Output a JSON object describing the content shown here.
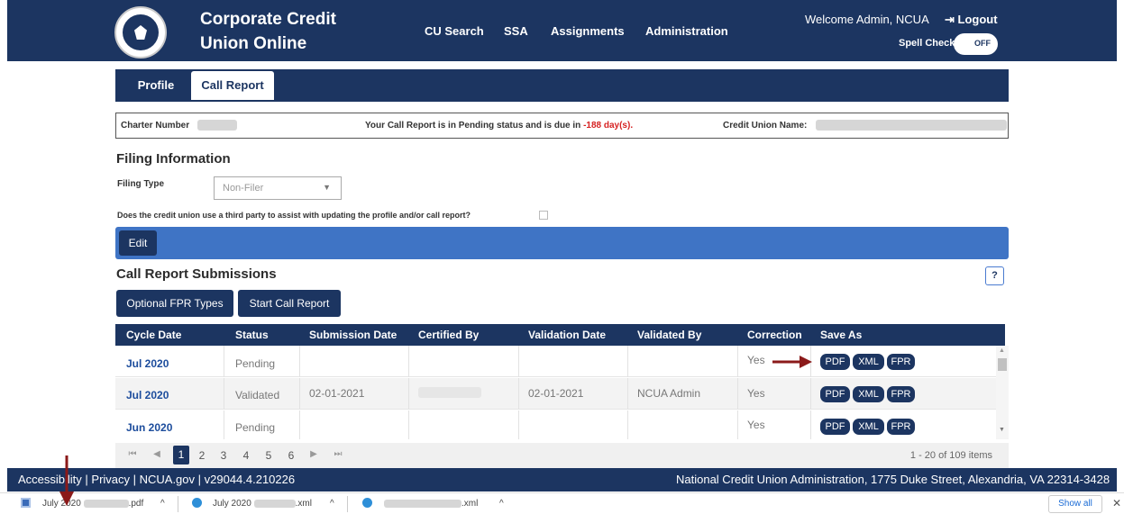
{
  "header": {
    "brand_line1": "Corporate Credit",
    "brand_line2": "Union Online",
    "nav": [
      "CU Search",
      "SSA",
      "Assignments",
      "Administration"
    ],
    "welcome": "Welcome Admin, NCUA",
    "logout": "Logout",
    "spell_check_label": "Spell Check",
    "spell_check_state": "OFF"
  },
  "tabs": [
    "Profile",
    "Call Report"
  ],
  "charter": {
    "charter_label": "Charter Number",
    "status_prefix": "Your Call Report is in Pending status and is due in",
    "due_days": "-188 day(s).",
    "cu_name_label": "Credit Union Name:"
  },
  "filing": {
    "heading": "Filing Information",
    "type_label": "Filing Type",
    "type_value": "Non-Filer",
    "third_party_question": "Does the credit union use a third party to assist with updating the profile and/or call report?",
    "edit_label": "Edit"
  },
  "submissions": {
    "heading": "Call Report Submissions",
    "help_label": "?",
    "optional_btn": "Optional FPR Types",
    "start_btn": "Start Call Report",
    "columns": [
      "Cycle Date",
      "Status",
      "Submission Date",
      "Certified By",
      "Validation Date",
      "Validated By",
      "Correction",
      "Save As"
    ],
    "rows": [
      {
        "cycle": "Jul 2020",
        "status": "Pending",
        "submission": "",
        "certified": "",
        "validation": "",
        "validated_by": "",
        "correction": "Yes"
      },
      {
        "cycle": "Jul 2020",
        "status": "Validated",
        "submission": "02-01-2021",
        "certified": "",
        "validation": "02-01-2021",
        "validated_by": "NCUA Admin",
        "correction": "Yes"
      },
      {
        "cycle": "Jun 2020",
        "status": "Pending",
        "submission": "",
        "certified": "",
        "validation": "",
        "validated_by": "",
        "correction": "Yes"
      }
    ],
    "save_formats": [
      "PDF",
      "XML",
      "FPR"
    ]
  },
  "pager": {
    "first": "⏮",
    "prev": "◀",
    "pages": [
      "1",
      "2",
      "3",
      "4",
      "5",
      "6"
    ],
    "next": "▶",
    "last": "⏭",
    "count_text": "1 - 20 of 109 items"
  },
  "footer": {
    "left": "Accessibility | Privacy | NCUA.gov | v29044.4.210226",
    "right": "National Credit Union Administration, 1775 Duke Street, Alexandria, VA 22314-3428"
  },
  "downloads": {
    "items": [
      {
        "prefix": "July 2020",
        "suffix": ".pdf"
      },
      {
        "prefix": "July 2020",
        "suffix": ".xml"
      },
      {
        "prefix": "",
        "suffix": ".xml"
      }
    ],
    "expand": "^",
    "show_all": "Show all",
    "close": "✕"
  },
  "colors": {
    "navy": "#1c3561",
    "blue_bar": "#3f74c5",
    "red": "#d62121",
    "arrow": "#8b1a1a"
  }
}
